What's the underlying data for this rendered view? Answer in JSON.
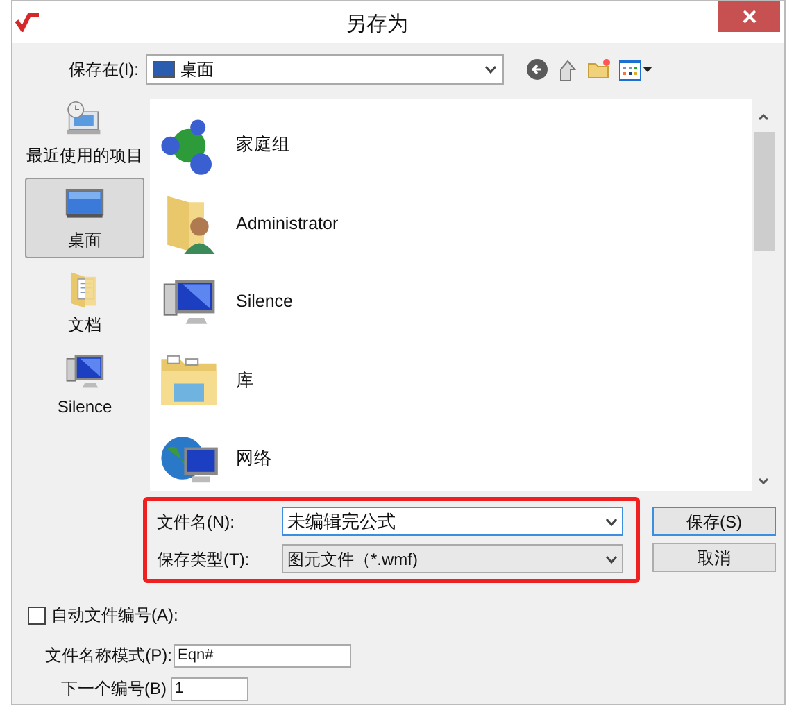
{
  "window": {
    "title": "另存为"
  },
  "save_in": {
    "label": "保存在(I):",
    "value": "桌面"
  },
  "places": [
    {
      "label": "最近使用的项目",
      "kind": "recent",
      "selected": false
    },
    {
      "label": "桌面",
      "kind": "desktop",
      "selected": true
    },
    {
      "label": "文档",
      "kind": "documents",
      "selected": false
    },
    {
      "label": "Silence",
      "kind": "computer",
      "selected": false
    }
  ],
  "files": [
    {
      "name": "家庭组",
      "kind": "homegroup"
    },
    {
      "name": "Administrator",
      "kind": "user"
    },
    {
      "name": "Silence",
      "kind": "computer"
    },
    {
      "name": "库",
      "kind": "library"
    },
    {
      "name": "网络",
      "kind": "network"
    }
  ],
  "file_name": {
    "label": "文件名(N):",
    "value": "未编辑完公式"
  },
  "save_type": {
    "label": "保存类型(T):",
    "value": "图元文件（*.wmf)"
  },
  "buttons": [
    {
      "label": "保存(S)",
      "default": true
    },
    {
      "label": "取消",
      "default": false
    }
  ],
  "auto_number": {
    "label": "自动文件编号(A):",
    "checked": false
  },
  "name_pattern": {
    "label": "文件名称模式(P):",
    "value": "Eqn#"
  },
  "next_number": {
    "label": "下一个编号(B)",
    "value": "1"
  }
}
